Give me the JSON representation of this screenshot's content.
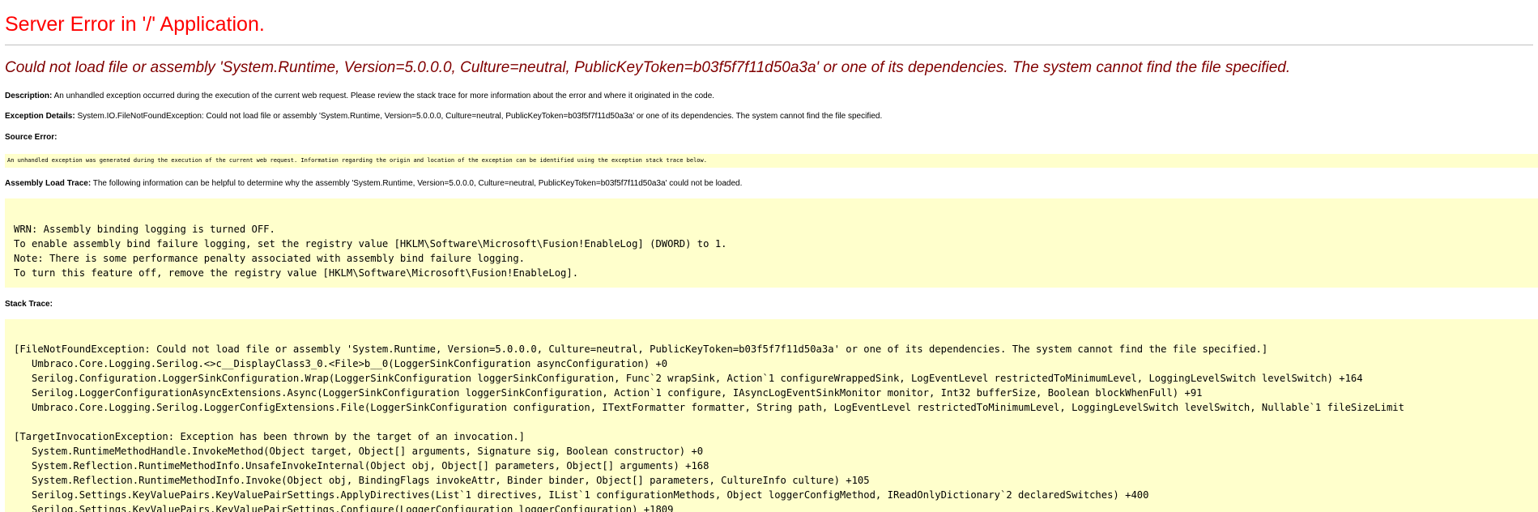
{
  "page": {
    "title": "Server Error in '/' Application.",
    "message": "Could not load file or assembly 'System.Runtime, Version=5.0.0.0, Culture=neutral, PublicKeyToken=b03f5f7f11d50a3a' or one of its dependencies. The system cannot find the file specified."
  },
  "description": {
    "label": "Description:",
    "text": " An unhandled exception occurred during the execution of the current web request. Please review the stack trace for more information about the error and where it originated in the code."
  },
  "exception_details": {
    "label": "Exception Details:",
    "text": " System.IO.FileNotFoundException: Could not load file or assembly 'System.Runtime, Version=5.0.0.0, Culture=neutral, PublicKeyToken=b03f5f7f11d50a3a' or one of its dependencies. The system cannot find the file specified."
  },
  "source_error": {
    "label": "Source Error:",
    "text": "An unhandled exception was generated during the execution of the current web request. Information regarding the origin and location of the exception can be identified using the exception stack trace below."
  },
  "assembly_load_trace": {
    "label": "Assembly Load Trace:",
    "text": " The following information can be helpful to determine why the assembly 'System.Runtime, Version=5.0.0.0, Culture=neutral, PublicKeyToken=b03f5f7f11d50a3a' could not be loaded.",
    "lines": [
      "WRN: Assembly binding logging is turned OFF.",
      "To enable assembly bind failure logging, set the registry value [HKLM\\Software\\Microsoft\\Fusion!EnableLog] (DWORD) to 1.",
      "Note: There is some performance penalty associated with assembly bind failure logging.",
      "To turn this feature off, remove the registry value [HKLM\\Software\\Microsoft\\Fusion!EnableLog]."
    ]
  },
  "stack_trace": {
    "label": "Stack Trace:",
    "lines": [
      "[FileNotFoundException: Could not load file or assembly 'System.Runtime, Version=5.0.0.0, Culture=neutral, PublicKeyToken=b03f5f7f11d50a3a' or one of its dependencies. The system cannot find the file specified.]",
      "   Umbraco.Core.Logging.Serilog.<>c__DisplayClass3_0.<File>b__0(LoggerSinkConfiguration asyncConfiguration) +0",
      "   Serilog.Configuration.LoggerSinkConfiguration.Wrap(LoggerSinkConfiguration loggerSinkConfiguration, Func`2 wrapSink, Action`1 configureWrappedSink, LogEventLevel restrictedToMinimumLevel, LoggingLevelSwitch levelSwitch) +164",
      "   Serilog.LoggerConfigurationAsyncExtensions.Async(LoggerSinkConfiguration loggerSinkConfiguration, Action`1 configure, IAsyncLogEventSinkMonitor monitor, Int32 bufferSize, Boolean blockWhenFull) +91",
      "   Umbraco.Core.Logging.Serilog.LoggerConfigExtensions.File(LoggerSinkConfiguration configuration, ITextFormatter formatter, String path, LogEventLevel restrictedToMinimumLevel, LoggingLevelSwitch levelSwitch, Nullable`1 fileSizeLimit",
      "",
      "[TargetInvocationException: Exception has been thrown by the target of an invocation.]",
      "   System.RuntimeMethodHandle.InvokeMethod(Object target, Object[] arguments, Signature sig, Boolean constructor) +0",
      "   System.Reflection.RuntimeMethodInfo.UnsafeInvokeInternal(Object obj, Object[] parameters, Object[] arguments) +168",
      "   System.Reflection.RuntimeMethodInfo.Invoke(Object obj, BindingFlags invokeAttr, Binder binder, Object[] parameters, CultureInfo culture) +105",
      "   Serilog.Settings.KeyValuePairs.KeyValuePairSettings.ApplyDirectives(List`1 directives, IList`1 configurationMethods, Object loggerConfigMethod, IReadOnlyDictionary`2 declaredSwitches) +400",
      "   Serilog.Settings.KeyValuePairs.KeyValuePairSettings.Configure(LoggerConfiguration loggerConfiguration) +1809"
    ]
  }
}
